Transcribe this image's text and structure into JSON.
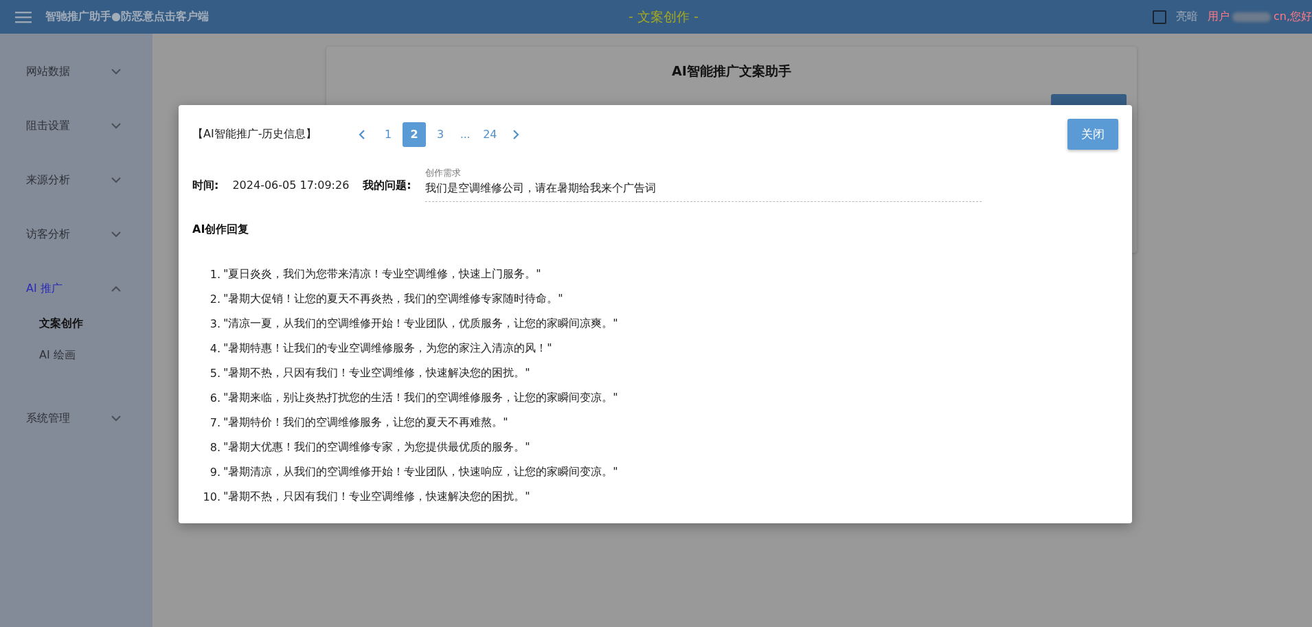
{
  "top_bar": {
    "app_title": "智驰推广助手●防恶意点击客户端",
    "page_title": "- 文案创作 -",
    "theme_toggle": {
      "label": "亮暗",
      "checked": false
    },
    "user_greeting_start": "用户",
    "user_greeting_end": "cn,您好"
  },
  "sidebar": {
    "items": [
      {
        "label": "网站数据",
        "expanded": false,
        "selected": false
      },
      {
        "label": "阻击设置",
        "expanded": false,
        "selected": false
      },
      {
        "label": "来源分析",
        "expanded": false,
        "selected": false
      },
      {
        "label": "访客分析",
        "expanded": false,
        "selected": false
      },
      {
        "label": "AI 推广",
        "expanded": true,
        "selected": true,
        "children": [
          {
            "label": "文案创作",
            "selected": true
          },
          {
            "label": "AI 绘画",
            "selected": false
          }
        ]
      },
      {
        "label": "系统管理",
        "expanded": false,
        "selected": false
      }
    ]
  },
  "card": {
    "title": "AI智能推广文案助手"
  },
  "dialog": {
    "title": "【AI智能推广-历史信息】",
    "pagination": [
      {
        "kind": "prev"
      },
      {
        "kind": "page",
        "label": "1",
        "selected": false
      },
      {
        "kind": "page",
        "label": "2",
        "selected": true
      },
      {
        "kind": "page",
        "label": "3",
        "selected": false
      },
      {
        "kind": "ellipsis",
        "label": "..."
      },
      {
        "kind": "page",
        "label": "24",
        "selected": false
      },
      {
        "kind": "next"
      }
    ],
    "close_button": "关闭",
    "time_label": "时间:",
    "time": "2024-06-05 17:09:26",
    "question_label": "我的问题:",
    "question": {
      "label": "创作需求",
      "value": "我们是空调维修公司，请在暑期给我来个广告词"
    },
    "reply_title": "AI创作回复",
    "replies": [
      {
        "number": "1.",
        "text": "\"夏日炎炎，我们为您带来清凉！专业空调维修，快速上门服务。\""
      },
      {
        "number": "2.",
        "text": "\"暑期大促销！让您的夏天不再炎热，我们的空调维修专家随时待命。\""
      },
      {
        "number": "3.",
        "text": "\"清凉一夏，从我们的空调维修开始！专业团队，优质服务，让您的家瞬间凉爽。\""
      },
      {
        "number": "4.",
        "text": "\"暑期特惠！让我们的专业空调维修服务，为您的家注入清凉的风！\""
      },
      {
        "number": "5.",
        "text": "\"暑期不热，只因有我们！专业空调维修，快速解决您的困扰。\""
      },
      {
        "number": "6.",
        "text": "\"暑期来临，别让炎热打扰您的生活！我们的空调维修服务，让您的家瞬间变凉。\""
      },
      {
        "number": "7.",
        "text": "\"暑期特价！我们的空调维修服务，让您的夏天不再难熬。\""
      },
      {
        "number": "8.",
        "text": "\"暑期大优惠！我们的空调维修专家，为您提供最优质的服务。\""
      },
      {
        "number": "9.",
        "text": "\"暑期清凉，从我们的空调维修开始！专业团队，快速响应，让您的家瞬间变凉。\""
      },
      {
        "number": "10.",
        "text": "\"暑期不热，只因有我们！专业空调维修，快速解决您的困扰。\""
      }
    ]
  }
}
